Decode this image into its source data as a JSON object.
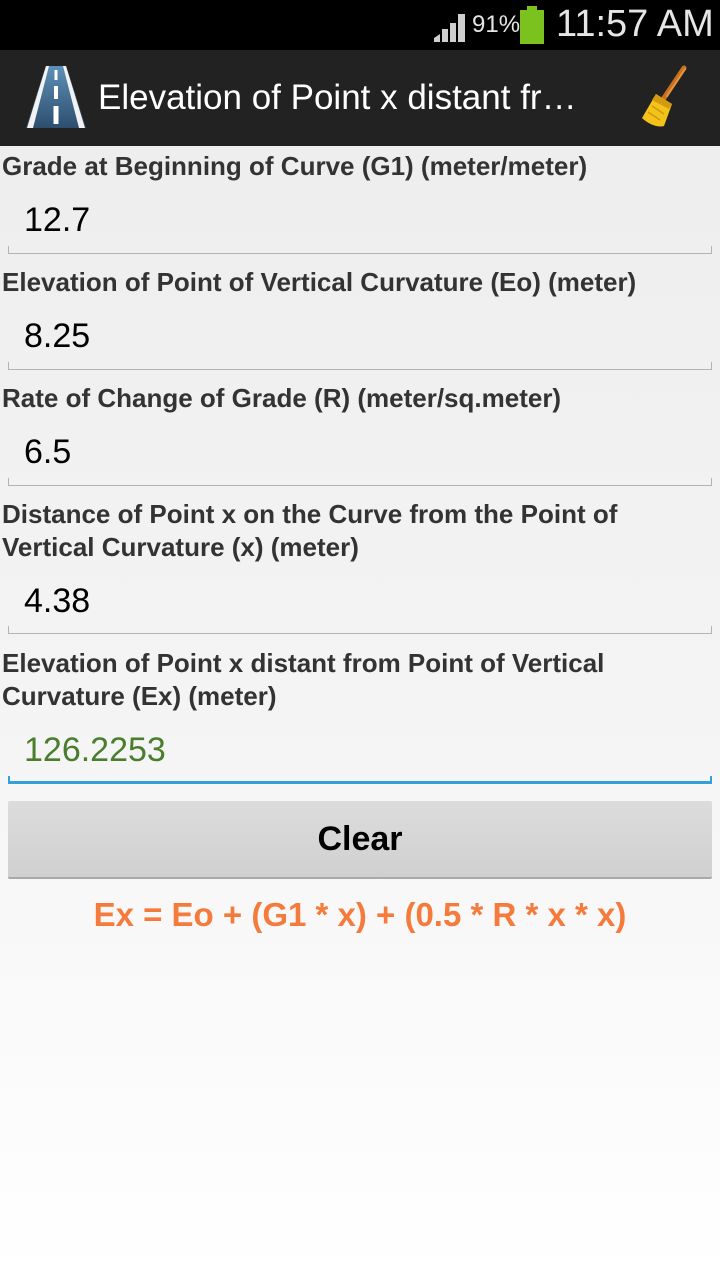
{
  "status_bar": {
    "battery_percent": "91%",
    "time": "11:57 AM",
    "signal_icon": "signal-bars-icon",
    "battery_icon": "battery-icon",
    "battery_color": "#7cc21e"
  },
  "action_bar": {
    "title": "Elevation of Point x distant fr…",
    "app_icon": "road-icon",
    "clear_icon": "broom-icon"
  },
  "fields": [
    {
      "label": "Grade at Beginning of Curve (G1) (meter/meter)",
      "value": "12.7"
    },
    {
      "label": "Elevation of Point of Vertical Curvature (Eo) (meter)",
      "value": "8.25"
    },
    {
      "label": "Rate of Change of Grade (R) (meter/sq.meter)",
      "value": "6.5"
    },
    {
      "label": "Distance of Point x on the Curve from the Point of Vertical Curvature (x) (meter)",
      "value": "4.38"
    },
    {
      "label": "Elevation of Point x distant from Point of Vertical Curvature (Ex) (meter)",
      "value": "126.2253"
    }
  ],
  "clear_button": {
    "label": "Clear"
  },
  "formula": "Ex = Eo + (G1 * x) + (0.5 * R * x * x)",
  "colors": {
    "accent_line": "#33a0d8",
    "result_text": "#4a7d2c",
    "formula_text": "#f47b3b",
    "action_bar_bg": "#222222"
  }
}
